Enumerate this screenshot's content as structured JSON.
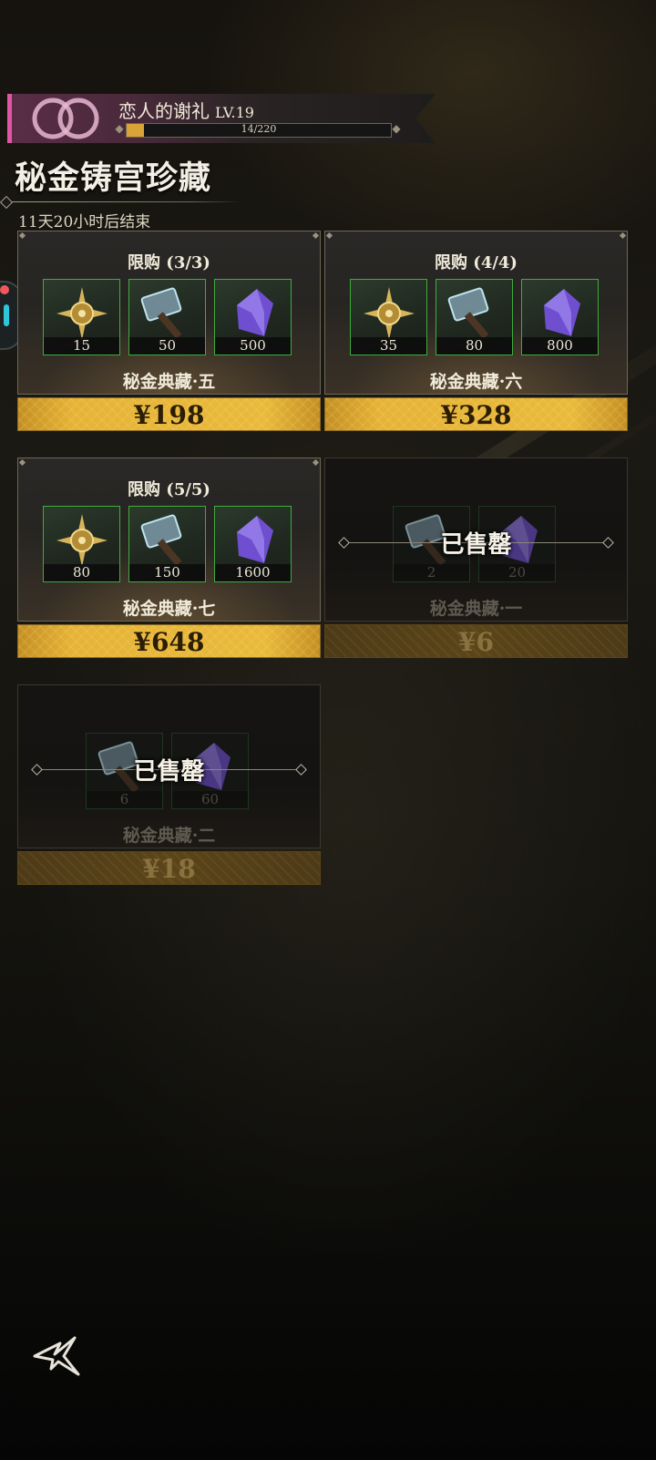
{
  "banner": {
    "title": "恋人的谢礼",
    "level": "LV.19",
    "xp_text": "14/220",
    "xp_progress": 0.064
  },
  "page": {
    "title": "秘金铸宫珍藏",
    "countdown": "11天20小时后结束"
  },
  "cards": [
    {
      "limit": "限购 (3/3)",
      "name": "秘金典藏·五",
      "price": "¥198",
      "sold": false,
      "items": [
        {
          "icon": "compass-medallion-icon",
          "qty": "15"
        },
        {
          "icon": "forge-hammer-icon",
          "qty": "50"
        },
        {
          "icon": "purple-crystal-icon",
          "qty": "500"
        }
      ]
    },
    {
      "limit": "限购 (4/4)",
      "name": "秘金典藏·六",
      "price": "¥328",
      "sold": false,
      "items": [
        {
          "icon": "compass-medallion-icon",
          "qty": "35"
        },
        {
          "icon": "forge-hammer-icon",
          "qty": "80"
        },
        {
          "icon": "purple-crystal-icon",
          "qty": "800"
        }
      ]
    },
    {
      "limit": "限购 (5/5)",
      "name": "秘金典藏·七",
      "price": "¥648",
      "sold": false,
      "items": [
        {
          "icon": "compass-medallion-icon",
          "qty": "80"
        },
        {
          "icon": "forge-hammer-icon",
          "qty": "150"
        },
        {
          "icon": "purple-crystal-icon",
          "qty": "1600"
        }
      ]
    },
    {
      "limit": "",
      "name": "秘金典藏·一",
      "price": "¥6",
      "sold": true,
      "sold_label": "已售罄",
      "items": [
        {
          "icon": "forge-hammer-icon",
          "qty": "2"
        },
        {
          "icon": "purple-crystal-icon",
          "qty": "20"
        }
      ]
    },
    {
      "limit": "",
      "name": "秘金典藏·二",
      "price": "¥18",
      "sold": true,
      "sold_label": "已售罄",
      "items": [
        {
          "icon": "forge-hammer-icon",
          "qty": "6"
        },
        {
          "icon": "purple-crystal-icon",
          "qty": "60"
        }
      ]
    }
  ],
  "colors": {
    "accent_gold": "#e6b336",
    "item_border": "#3dad3c",
    "banner_pink": "#e254a4"
  }
}
